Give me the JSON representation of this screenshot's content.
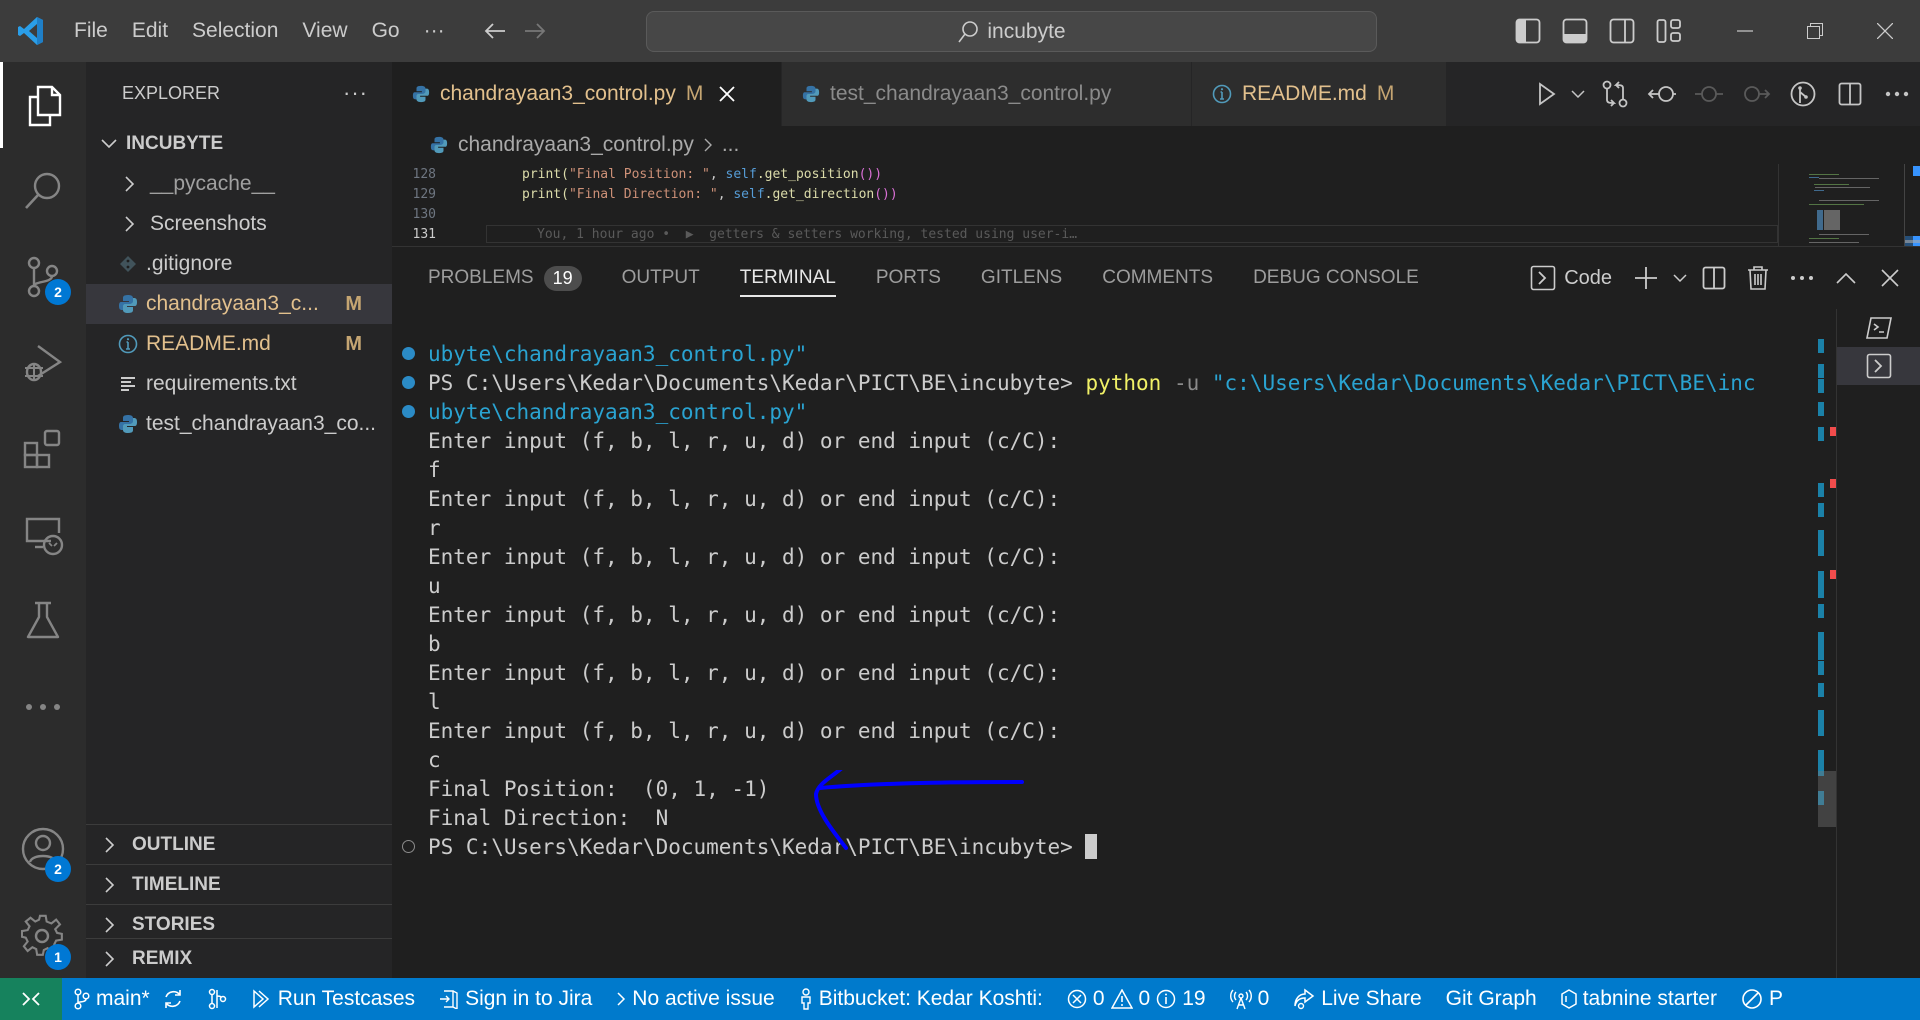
{
  "titlebar": {
    "menu": [
      "File",
      "Edit",
      "Selection",
      "View",
      "Go",
      "···"
    ],
    "search_text": "incubyte",
    "accent": "#0078d4"
  },
  "activity": {
    "source_control_badge": "2",
    "accounts_badge": "2",
    "settings_badge": "1"
  },
  "sidebar": {
    "title": "EXPLORER",
    "more": "···",
    "folder": "INCUBYTE",
    "items": [
      {
        "label": "__pycache__",
        "type": "folder"
      },
      {
        "label": "Screenshots",
        "type": "folder"
      },
      {
        "label": ".gitignore",
        "type": "git"
      },
      {
        "label": "chandrayaan3_c...",
        "type": "python",
        "badge": "M"
      },
      {
        "label": "README.md",
        "type": "info",
        "badge": "M"
      },
      {
        "label": "requirements.txt",
        "type": "text"
      },
      {
        "label": "test_chandrayaan3_co...",
        "type": "python"
      }
    ],
    "sections": [
      "OUTLINE",
      "TIMELINE",
      "STORIES",
      "REMIX"
    ]
  },
  "tabs": [
    {
      "label": "chandrayaan3_control.py",
      "badge": "M",
      "active": true
    },
    {
      "label": "test_chandrayaan3_control.py",
      "badge": ""
    },
    {
      "label": "README.md",
      "badge": "M"
    }
  ],
  "breadcrumb": {
    "file": "chandrayaan3_control.py",
    "rest": "..."
  },
  "code": {
    "lines": [
      {
        "num": "128",
        "pre": "print(",
        "str": "\"Final Position: \"",
        "mid": ", ",
        "self": "self",
        "call": ".get_position",
        "end": "())"
      },
      {
        "num": "129",
        "pre": "print(",
        "str": "\"Final Direction: \"",
        "mid": ", ",
        "self": "self",
        "call": ".get_direction",
        "end": "())"
      },
      {
        "num": "130"
      },
      {
        "num": "131",
        "blame": "You, 1 hour ago •  ▶  getters & setters working, tested using user-i…"
      }
    ]
  },
  "panel": {
    "tabs": [
      {
        "label": "PROBLEMS",
        "count": "19"
      },
      {
        "label": "OUTPUT"
      },
      {
        "label": "TERMINAL",
        "active": true
      },
      {
        "label": "PORTS"
      },
      {
        "label": "GITLENS"
      },
      {
        "label": "COMMENTS"
      },
      {
        "label": "DEBUG CONSOLE"
      }
    ],
    "terminal_name": "Code"
  },
  "terminal": {
    "lines": [
      {
        "dot": "filled",
        "parts": [
          {
            "t": "ubyte\\chandrayaan3_control.py\"",
            "c": "blue"
          }
        ]
      },
      {
        "dot": "filled",
        "parts": [
          {
            "t": "PS C:\\Users\\Kedar\\Documents\\Kedar\\PICT\\BE\\incubyte> ",
            "c": ""
          },
          {
            "t": "python",
            "c": "yellow"
          },
          {
            "t": " -u ",
            "c": "grey"
          },
          {
            "t": "\"c:\\Users\\Kedar\\Documents\\Kedar\\PICT\\BE\\inc",
            "c": "blue"
          }
        ]
      },
      {
        "dot": "filled",
        "parts": [
          {
            "t": "ubyte\\chandrayaan3_control.py\"",
            "c": "blue"
          }
        ]
      },
      {
        "parts": [
          {
            "t": "Enter input (f, b, l, r, u, d) or end input (c/C):",
            "c": ""
          }
        ]
      },
      {
        "parts": [
          {
            "t": "f",
            "c": ""
          }
        ]
      },
      {
        "parts": [
          {
            "t": "Enter input (f, b, l, r, u, d) or end input (c/C):",
            "c": ""
          }
        ]
      },
      {
        "parts": [
          {
            "t": "r",
            "c": ""
          }
        ]
      },
      {
        "parts": [
          {
            "t": "Enter input (f, b, l, r, u, d) or end input (c/C):",
            "c": ""
          }
        ]
      },
      {
        "parts": [
          {
            "t": "u",
            "c": ""
          }
        ]
      },
      {
        "parts": [
          {
            "t": "Enter input (f, b, l, r, u, d) or end input (c/C):",
            "c": ""
          }
        ]
      },
      {
        "parts": [
          {
            "t": "b",
            "c": ""
          }
        ]
      },
      {
        "parts": [
          {
            "t": "Enter input (f, b, l, r, u, d) or end input (c/C):",
            "c": ""
          }
        ]
      },
      {
        "parts": [
          {
            "t": "l",
            "c": ""
          }
        ]
      },
      {
        "parts": [
          {
            "t": "Enter input (f, b, l, r, u, d) or end input (c/C):",
            "c": ""
          }
        ]
      },
      {
        "parts": [
          {
            "t": "c",
            "c": ""
          }
        ]
      },
      {
        "parts": [
          {
            "t": "Final Position:  (0, 1, -1)",
            "c": ""
          }
        ]
      },
      {
        "parts": [
          {
            "t": "Final Direction:  N",
            "c": ""
          }
        ]
      },
      {
        "dot": "hollow",
        "cursor": true,
        "parts": [
          {
            "t": "PS C:\\Users\\Kedar\\Documents\\Kedar\\PICT\\BE\\incubyte>",
            "c": ""
          }
        ]
      }
    ],
    "annotation_color": "#0000ff"
  },
  "statusbar": {
    "branch": "main*",
    "run_testcases": "Run Testcases",
    "jira": "Sign in to Jira",
    "issue": "No active issue",
    "bitbucket": "Bitbucket: Kedar Koshti:",
    "errors": "0",
    "warnings": "0",
    "infos": "19",
    "ports": "0",
    "live_share": "Live Share",
    "git_graph": "Git Graph",
    "tabnine": "tabnine starter",
    "cut_off": "P",
    "bg_color": "#007acc",
    "remote_color": "#16825d"
  }
}
